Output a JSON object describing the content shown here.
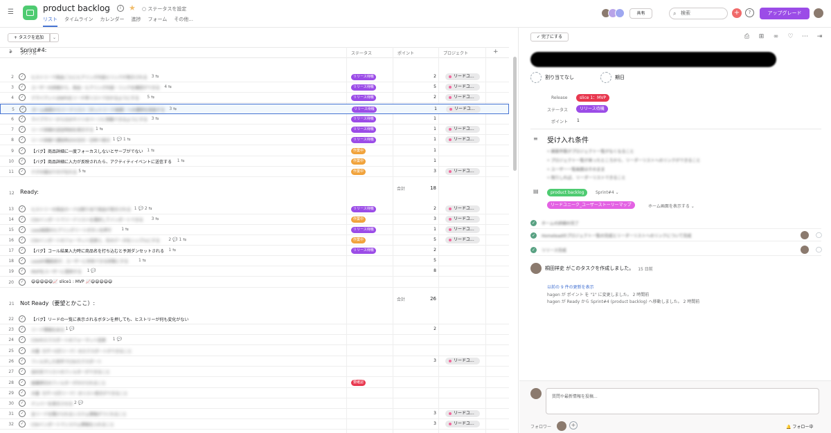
{
  "header": {
    "project_title": "product backlog",
    "status_label": "ステータスを設定",
    "views": [
      "リスト",
      "タイムライン",
      "カレンダー",
      "進捗",
      "フォーム",
      "その他..."
    ],
    "share_label": "共有",
    "search_placeholder": "検索",
    "help_label": "?",
    "upgrade_label": "アップグレード",
    "accent_color": "#4573d2"
  },
  "list": {
    "add_task_label": "+ タスクを追加",
    "columns": {
      "num": "#",
      "task": "タスク名",
      "status": "ステータス",
      "points": "ポイント",
      "project": "プロジェクト",
      "add": "+"
    },
    "sections": [
      {
        "num": "1",
        "title": "Sprint#4:"
      },
      {
        "num": "12",
        "title": "Ready:"
      },
      {
        "num": "21",
        "title": "Not Ready（要望とかここ）:"
      }
    ],
    "summary_label": "合計",
    "summary_values": [
      "18",
      "26"
    ],
    "rows": [
      {
        "num": "2",
        "name": "ヒストリーで商品ごとにヒアリング内容とリンクが表示される",
        "meta": "3 ⇆",
        "status": "リリース待機",
        "status_color": "#9b4ce7",
        "points": "2",
        "project": "リードユ..."
      },
      {
        "num": "3",
        "name": "ユーザーの詳細から、商品・ヒアリング内容・リンクを確認ができる",
        "meta": "4 ⇆",
        "status": "リリース待機",
        "status_color": "#9b4ce7",
        "points": "5",
        "project": "リードユ..."
      },
      {
        "num": "4",
        "name": "クライアントはNPSをリーチ率リストで分かるようにする",
        "meta": "5 ⇆",
        "status": "リリース待機",
        "status_color": "#9b4ce7",
        "points": "2",
        "project": "リードユ..."
      },
      {
        "num": "5",
        "name": "ホーム画面からリードリスト（ホットリード画面）への遷移を実装する",
        "meta": "3 ⇆",
        "status": "リリース待機",
        "status_color": "#9b4ce7",
        "points": "1",
        "project": "リードユ..."
      },
      {
        "num": "6",
        "name": "ライブラリーから元のサイトのページに移動できるようにする",
        "meta": "3 ⇆",
        "status": "リリース待機",
        "status_color": "#9b4ce7",
        "points": "1",
        "project": ""
      },
      {
        "num": "7",
        "name": "リード詳細の送信時刻を表示する",
        "meta": "1 ⇆",
        "status": "リリース待機",
        "status_color": "#9b4ce7",
        "points": "1",
        "project": "リードユ..."
      },
      {
        "num": "8",
        "name": "リード詳細で通知時点の日付・日時で表示",
        "meta": "1 💬 1 ⇆",
        "status": "リリース待機",
        "status_color": "#9b4ce7",
        "points": "1",
        "project": "リードユ..."
      },
      {
        "num": "9",
        "name": "【バグ】商品詳細に一度フォーカスしないとサーブがでない",
        "meta": "1 ⇆",
        "status": "作業中",
        "status_color": "#f1a33c",
        "points": "1",
        "project": ""
      },
      {
        "num": "10",
        "name": "【バグ】商品詳細に入力が反映されたら、アクティティイベントに送信する",
        "meta": "1 ⇆",
        "status": "作業中",
        "status_color": "#f1a33c",
        "points": "1",
        "project": ""
      },
      {
        "num": "11",
        "name": "テグの値はウタグをれる",
        "meta": "5 ⇆",
        "status": "作業中",
        "status_color": "#f1a33c",
        "points": "3",
        "project": "リードユ..."
      },
      {
        "num": "13",
        "name": "ヒストリーの商品カードは割り当て商品が表示される",
        "meta": "1 💬 2 ⇆",
        "status": "リリース待機",
        "status_color": "#9b4ce7",
        "points": "2",
        "project": "リードユ..."
      },
      {
        "num": "14",
        "name": "CSVインポートでリードリストを選択してインポートできる",
        "meta": "3 ⇆",
        "status": "作業中",
        "status_color": "#f1a33c",
        "points": "3",
        "project": "リードユ..."
      },
      {
        "num": "15",
        "name": "Lead画面のヒアリングリートボタンを押す",
        "meta": "1 ⇆",
        "status": "リリース待機",
        "status_color": "#9b4ce7",
        "points": "1",
        "project": "リードユ..."
      },
      {
        "num": "16",
        "name": "CSVインポートのフォーマット変更と、社のデータをシンプルにする",
        "meta": "2 💬 1 ⇆",
        "status": "作業中",
        "status_color": "#f1a33c",
        "points": "5",
        "project": "リードユ..."
      },
      {
        "num": "17",
        "name": "【バグ】コール結果入力時に商品名を打ち込むと予測ダンセットされる",
        "meta": "1 ⇆",
        "status": "リリース待機",
        "status_color": "#9b4ce7",
        "points": "2",
        "project": ""
      },
      {
        "num": "18",
        "name": "Leadの機能前が、ユーザーに共有できる状態にする",
        "meta": "1 ⇆",
        "status": "",
        "status_color": "",
        "points": "5",
        "project": ""
      },
      {
        "num": "19",
        "name": "MVPをユーザーに提供する",
        "meta": "1 💬",
        "status": "",
        "status_color": "",
        "points": "8",
        "project": ""
      },
      {
        "num": "20",
        "name": "😄😄😄😄😄📈 slice1 : MVP 📈😄😄😄😄😄",
        "meta": "",
        "status": "",
        "status_color": "",
        "points": "",
        "project": ""
      },
      {
        "num": "22",
        "name": "【バグ】リードの一覧に表示されるボタンを押しても、ヒストリーが何も変化がない",
        "meta": "",
        "status": "",
        "status_color": "",
        "points": "",
        "project": ""
      },
      {
        "num": "23",
        "name": "リード情報をある",
        "meta": "1 💬",
        "status": "",
        "status_color": "",
        "points": "2",
        "project": ""
      },
      {
        "num": "24",
        "name": "CSVのエクスポートのフォーマット変更",
        "meta": "1 💬",
        "status": "",
        "status_color": "",
        "points": "",
        "project": ""
      },
      {
        "num": "25",
        "name": "大量（5千〜5万リード）のエクスポートができること",
        "meta": "",
        "status": "",
        "status_color": "",
        "points": "",
        "project": ""
      },
      {
        "num": "26",
        "name": "フィルタした条件でCSVエクスポート",
        "meta": "",
        "status": "",
        "status_color": "",
        "points": "3",
        "project": "リードユ..."
      },
      {
        "num": "27",
        "name": "会社名でリストのフィルターができること",
        "meta": "",
        "status": "",
        "status_color": "",
        "points": "",
        "project": ""
      },
      {
        "num": "28",
        "name": "組織単位のフィルターがかけられること",
        "meta": "",
        "status": "要確認",
        "status_color": "#e8384f",
        "points": "",
        "project": ""
      },
      {
        "num": "29",
        "name": "大量（5千〜5万リード）のリスト表示ができること",
        "meta": "",
        "status": "",
        "status_color": "",
        "points": "",
        "project": ""
      },
      {
        "num": "30",
        "name": "ナンバーを表示させる",
        "meta": "2 💬",
        "status": "",
        "status_color": "",
        "points": "",
        "project": ""
      },
      {
        "num": "31",
        "name": "全リードを開けられるシステム情報がつくれること",
        "meta": "",
        "status": "",
        "status_color": "",
        "points": "3",
        "project": "リードユ..."
      },
      {
        "num": "32",
        "name": "CSVインポートでシステム情報を入れること",
        "meta": "",
        "status": "",
        "status_color": "",
        "points": "3",
        "project": "リードユ..."
      }
    ]
  },
  "detail": {
    "complete_label": "完了にする",
    "assignee_label": "割り当てなし",
    "due_label": "期日",
    "field_release_label": "Release",
    "field_release_value": "slice 1：MVP",
    "field_status_label": "ステータス",
    "field_status_value": "リリース待機",
    "field_points_label": "ポイント",
    "field_points_value": "1",
    "section_title": "受け入れ条件",
    "bullets": [
      "検索件数がプロジェクト一覧がなくなること",
      "プロジェクト一覧が来ったところから、リーダーリストへのリンクができること",
      "ユーザー一覧画面はそのまま",
      "残りしれば、リーダーリストできること"
    ],
    "project_tag": "product backlog",
    "project_section": "Sprint#4",
    "parent_tag": "リードユニーク_ユーザーストーリーマップ",
    "parent_section": "ホーム画面を表示する",
    "subtasks": [
      "ホームの詳細の完了",
      "Homeleadのプロジェクト一覧の完成とリーダーリストへのリンクについて完成",
      "リリース完成"
    ],
    "activity_text": "桐田祥史 がこのタスクを作成しました。",
    "activity_date": "15 日前",
    "more_updates": "以前の 9 件の更新を表示",
    "log1": "hagen が ポイント を \"1\" に変更しました。  2 時間前",
    "log2": "hagen が Ready から Sprint#4 (product backlog) へ移動しました。  2 時間前",
    "comment_placeholder": "質問や最新情報を投稿...",
    "followers_label": "フォロワー",
    "unfollow_label": "フォロー中",
    "tag_colors": {
      "release": "#e8384f",
      "status": "#9b4ce7",
      "project": "#4ecb71",
      "parent": "#e362e3"
    }
  }
}
